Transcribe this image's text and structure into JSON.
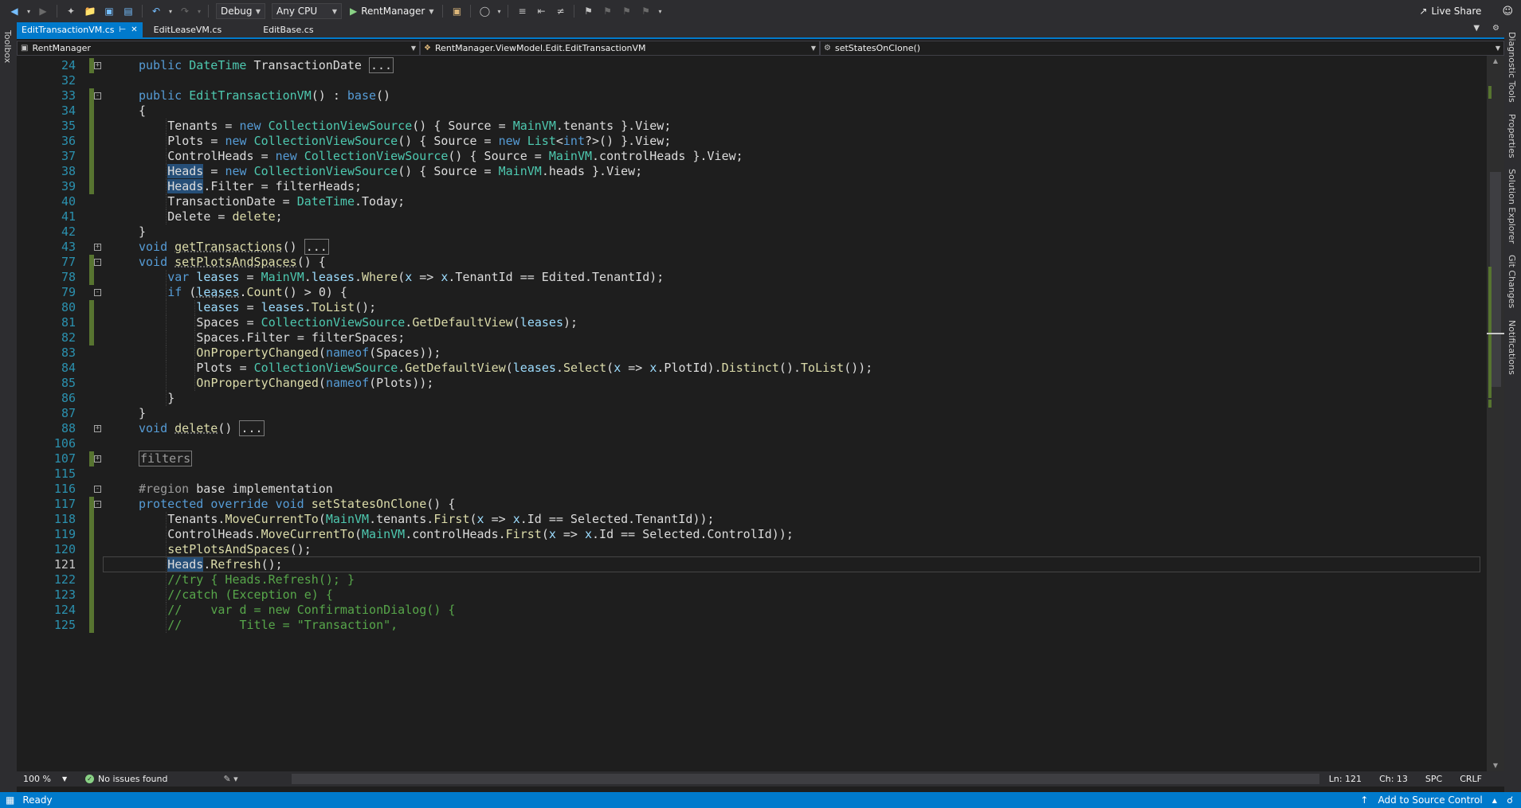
{
  "toolbar": {
    "configuration": "Debug",
    "platform": "Any CPU",
    "start_project": "RentManager",
    "live_share": "Live Share"
  },
  "left_strip": {
    "toolbox": "Toolbox"
  },
  "right_strip": [
    "Diagnostic Tools",
    "Properties",
    "Solution Explorer",
    "Git Changes",
    "Notifications"
  ],
  "tabs": [
    {
      "label": "EditTransactionVM.cs",
      "active": true
    },
    {
      "label": "EditLeaseVM.cs",
      "active": false
    },
    {
      "label": "EditBase.cs",
      "active": false
    }
  ],
  "navbar": {
    "project": "RentManager",
    "type": "RentManager.ViewModel.Edit.EditTransactionVM",
    "member": "setStatesOnClone()"
  },
  "editor": {
    "lines": [
      {
        "n": "24",
        "code": "public DateTime TransactionDate ..."
      },
      {
        "n": "32",
        "code": ""
      },
      {
        "n": "33",
        "code": "public EditTransactionVM() : base()"
      },
      {
        "n": "34",
        "code": "{"
      },
      {
        "n": "35",
        "code": "Tenants = new CollectionViewSource() { Source = MainVM.tenants }.View;"
      },
      {
        "n": "36",
        "code": "Plots = new CollectionViewSource() { Source = new List<int?>() }.View;"
      },
      {
        "n": "37",
        "code": "ControlHeads = new CollectionViewSource() { Source = MainVM.controlHeads }.View;"
      },
      {
        "n": "38",
        "code": "Heads = new CollectionViewSource() { Source = MainVM.heads }.View;"
      },
      {
        "n": "39",
        "code": "Heads.Filter = filterHeads;"
      },
      {
        "n": "40",
        "code": "TransactionDate = DateTime.Today;"
      },
      {
        "n": "41",
        "code": "Delete = delete;"
      },
      {
        "n": "42",
        "code": "}"
      },
      {
        "n": "43",
        "code": "void getTransactions() ..."
      },
      {
        "n": "77",
        "code": "void setPlotsAndSpaces() {"
      },
      {
        "n": "78",
        "code": "var leases = MainVM.leases.Where(x => x.TenantId == Edited.TenantId);"
      },
      {
        "n": "79",
        "code": "if (leases.Count() > 0) {"
      },
      {
        "n": "80",
        "code": "leases = leases.ToList();"
      },
      {
        "n": "81",
        "code": "Spaces = CollectionViewSource.GetDefaultView(leases);"
      },
      {
        "n": "82",
        "code": "Spaces.Filter = filterSpaces;"
      },
      {
        "n": "83",
        "code": "OnPropertyChanged(nameof(Spaces));"
      },
      {
        "n": "84",
        "code": "Plots = CollectionViewSource.GetDefaultView(leases.Select(x => x.PlotId).Distinct().ToList());"
      },
      {
        "n": "85",
        "code": "OnPropertyChanged(nameof(Plots));"
      },
      {
        "n": "86",
        "code": "}"
      },
      {
        "n": "87",
        "code": "}"
      },
      {
        "n": "88",
        "code": "void delete() ..."
      },
      {
        "n": "106",
        "code": ""
      },
      {
        "n": "107",
        "code": "filters"
      },
      {
        "n": "115",
        "code": ""
      },
      {
        "n": "116",
        "code": "#region base implementation"
      },
      {
        "n": "117",
        "code": "protected override void setStatesOnClone() {"
      },
      {
        "n": "118",
        "code": "Tenants.MoveCurrentTo(MainVM.tenants.First(x => x.Id == Selected.TenantId));"
      },
      {
        "n": "119",
        "code": "ControlHeads.MoveCurrentTo(MainVM.controlHeads.First(x => x.Id == Selected.ControlId));"
      },
      {
        "n": "120",
        "code": "setPlotsAndSpaces();"
      },
      {
        "n": "121",
        "code": "Heads.Refresh();"
      },
      {
        "n": "122",
        "code": "//try { Heads.Refresh(); }"
      },
      {
        "n": "123",
        "code": "//catch (Exception e) {"
      },
      {
        "n": "124",
        "code": "//    var d = new ConfirmationDialog() {"
      },
      {
        "n": "125",
        "code": "//        Title = \"Transaction\","
      }
    ]
  },
  "editor_status": {
    "zoom": "100 %",
    "issues": "No issues found",
    "line": "Ln: 121",
    "col": "Ch: 13",
    "whitespace": "SPC",
    "line_ending": "CRLF"
  },
  "statusbar": {
    "state": "Ready",
    "source_control": "Add to Source Control"
  },
  "colors": {
    "accent": "#007acc",
    "keyword": "#569cd6",
    "type": "#4ec9b0",
    "method": "#dcdcaa",
    "comment": "#57a64a",
    "line_number": "#2b91af"
  },
  "icons": [
    "back-icon",
    "forward-icon",
    "new-project-icon",
    "open-folder-icon",
    "save-icon",
    "save-all-icon",
    "undo-icon",
    "redo-icon",
    "play-icon",
    "live-share-icon",
    "feedback-icon",
    "ready-icon",
    "branch-icon"
  ]
}
